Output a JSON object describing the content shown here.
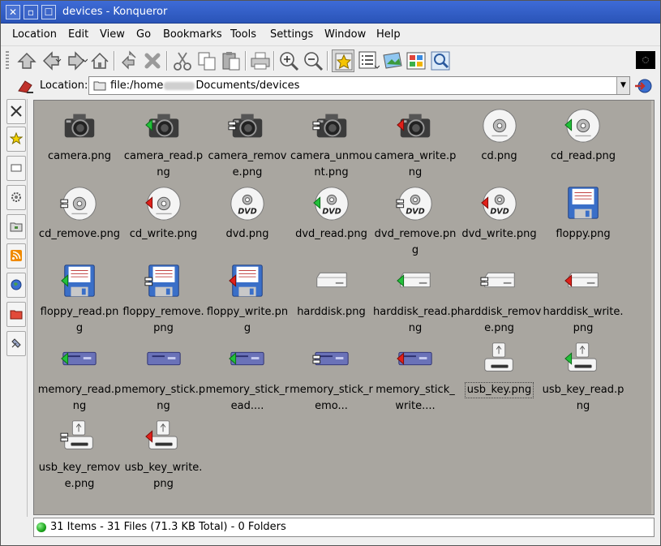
{
  "window": {
    "title": "devices - Konqueror",
    "buttons": {
      "close": "✕",
      "min": "▫",
      "max": "☐"
    }
  },
  "menu": {
    "items": [
      "Location",
      "Edit",
      "View",
      "Go",
      "Bookmarks",
      "Tools",
      "Settings",
      "Window",
      "Help"
    ]
  },
  "toolbar": {
    "icons": [
      "up-arrow-icon",
      "back-arrow-icon",
      "forward-arrow-icon",
      "home-icon",
      "reload-icon",
      "stop-icon",
      "cut-icon",
      "copy-icon",
      "paste-icon",
      "print-icon",
      "zoom-in-icon",
      "zoom-out-icon",
      "bookmark-star-icon",
      "list-view-icon",
      "image-view-icon",
      "icon-view-icon",
      "preview-icon"
    ]
  },
  "location": {
    "label": "Location:",
    "url_prefix": "file:/home",
    "url_suffix": "Documents/devices"
  },
  "sidebar": {
    "tabs": [
      "tools-icon",
      "bookmarks-icon",
      "devices-icon",
      "settings-icon",
      "folder-icon",
      "feed-icon",
      "network-icon",
      "home-folder-icon",
      "services-icon"
    ]
  },
  "files": [
    {
      "label": "camera.png",
      "icon": "camera",
      "mark": "none"
    },
    {
      "label": "camera_read.png",
      "icon": "camera",
      "mark": "green"
    },
    {
      "label": "camera_remove.png",
      "icon": "camera",
      "mark": "minus"
    },
    {
      "label": "camera_unmount.png",
      "icon": "camera",
      "mark": "eject"
    },
    {
      "label": "camera_write.png",
      "icon": "camera",
      "mark": "red"
    },
    {
      "label": "cd.png",
      "icon": "cd",
      "mark": "none"
    },
    {
      "label": "cd_read.png",
      "icon": "cd",
      "mark": "green"
    },
    {
      "label": "cd_remove.png",
      "icon": "cd",
      "mark": "minus"
    },
    {
      "label": "cd_write.png",
      "icon": "cd",
      "mark": "red"
    },
    {
      "label": "dvd.png",
      "icon": "dvd",
      "mark": "none"
    },
    {
      "label": "dvd_read.png",
      "icon": "dvd",
      "mark": "green"
    },
    {
      "label": "dvd_remove.png",
      "icon": "dvd",
      "mark": "minus"
    },
    {
      "label": "dvd_write.png",
      "icon": "dvd",
      "mark": "red"
    },
    {
      "label": "floppy.png",
      "icon": "floppy",
      "mark": "none"
    },
    {
      "label": "floppy_read.png",
      "icon": "floppy",
      "mark": "green"
    },
    {
      "label": "floppy_remove.png",
      "icon": "floppy",
      "mark": "minus"
    },
    {
      "label": "floppy_write.png",
      "icon": "floppy",
      "mark": "red"
    },
    {
      "label": "harddisk.png",
      "icon": "harddisk",
      "mark": "none"
    },
    {
      "label": "harddisk_read.png",
      "icon": "harddisk",
      "mark": "green"
    },
    {
      "label": "harddisk_remove.png",
      "icon": "harddisk",
      "mark": "minus"
    },
    {
      "label": "harddisk_write.png",
      "icon": "harddisk",
      "mark": "red"
    },
    {
      "label": "memory_read.png",
      "icon": "memory",
      "mark": "green"
    },
    {
      "label": "memory_stick.png",
      "icon": "memory",
      "mark": "none"
    },
    {
      "label": "memory_stick_read....",
      "icon": "memory",
      "mark": "green"
    },
    {
      "label": "memory_stick_remo...",
      "icon": "memory",
      "mark": "minus"
    },
    {
      "label": "memory_stick_write....",
      "icon": "memory",
      "mark": "red"
    },
    {
      "label": "usb_key.png",
      "icon": "usb",
      "mark": "none",
      "selected": true
    },
    {
      "label": "usb_key_read.png",
      "icon": "usb",
      "mark": "green"
    },
    {
      "label": "usb_key_remove.png",
      "icon": "usb",
      "mark": "minus"
    },
    {
      "label": "usb_key_write.png",
      "icon": "usb",
      "mark": "red"
    }
  ],
  "status": {
    "text": "31 Items - 31 Files (71.3 KB Total) - 0 Folders"
  }
}
